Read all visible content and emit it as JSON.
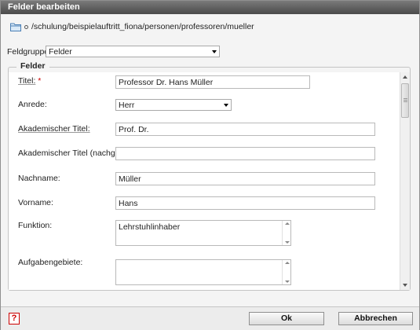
{
  "dialog": {
    "title": "Felder bearbeiten"
  },
  "path": {
    "text": "/schulung/beispielauftritt_fiona/personen/professoren/mueller"
  },
  "fieldgroup": {
    "label": "Feldgruppe:",
    "value": "Felder"
  },
  "fieldset": {
    "legend": "Felder"
  },
  "fields": {
    "titel": {
      "label": "Titel:",
      "required_mark": "*",
      "value": "Professor Dr. Hans Müller"
    },
    "anrede": {
      "label": "Anrede:",
      "value": "Herr"
    },
    "akad_titel": {
      "label": "Akademischer Titel:",
      "value": "Prof. Dr."
    },
    "akad_titel_nach": {
      "label": "Akademischer Titel (nachgestellt):",
      "value": ""
    },
    "nachname": {
      "label": "Nachname:",
      "value": "Müller"
    },
    "vorname": {
      "label": "Vorname:",
      "value": "Hans"
    },
    "funktion": {
      "label": "Funktion:",
      "value": "Lehrstuhlinhaber"
    },
    "aufgaben": {
      "label": "Aufgabengebiete:",
      "value": ""
    }
  },
  "footer": {
    "help": "?",
    "ok": "Ok",
    "cancel": "Abbrechen"
  },
  "colors": {
    "titlebar": "#4a4a4a",
    "required": "#cc0000",
    "help_icon": "#cc0000"
  }
}
